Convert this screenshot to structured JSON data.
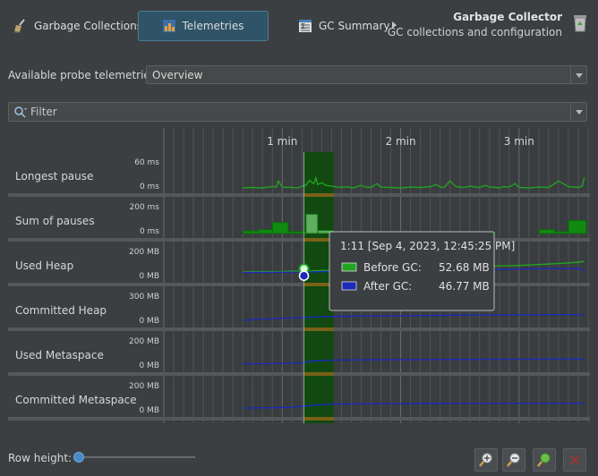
{
  "toolbar": {
    "tabs": [
      {
        "label": "Garbage Collections",
        "active": false,
        "icon": "broom-icon"
      },
      {
        "label": "Telemetries",
        "active": true,
        "icon": "telemetry-chart-icon"
      },
      {
        "label": "GC Summary",
        "active": false,
        "icon": "summary-table-icon"
      }
    ],
    "header_title": "Garbage Collector",
    "header_subtitle": "GC collections and configuration"
  },
  "probe": {
    "label": "Available probe telemetries:",
    "selected": "Overview"
  },
  "filter": {
    "placeholder": "Filter"
  },
  "chart_data": {
    "type": "line",
    "x_unit": "min",
    "x_ticks": [
      {
        "label": "1 min",
        "value": 60
      },
      {
        "label": "2 min",
        "value": 120
      },
      {
        "label": "3 min",
        "value": 180
      }
    ],
    "xlim": [
      0,
      215
    ],
    "highlight_range": [
      71,
      86
    ],
    "cursor_x": 71,
    "rows": [
      {
        "label": "Longest pause",
        "ymax_label": "60 ms",
        "ymin_label": "0 ms",
        "ymax": 60,
        "kind": "pause",
        "series": [
          {
            "name": "Longest pause",
            "color": "#21a121",
            "x": [
              40,
              45,
              50,
              55,
              57,
              58,
              60,
              65,
              68,
              70,
              72,
              74,
              75,
              76,
              77,
              78,
              80,
              82,
              85,
              88,
              90,
              93,
              95,
              97,
              100,
              102,
              105,
              108,
              110,
              115,
              120,
              125,
              130,
              135,
              138,
              140,
              142,
              145,
              148,
              150,
              152,
              155,
              158,
              160,
              163,
              165,
              168,
              170,
              172,
              175,
              178,
              180,
              185,
              190,
              195,
              200,
              205,
              210,
              212,
              213
            ],
            "y": [
              2,
              3,
              2,
              5,
              4,
              18,
              4,
              3,
              2,
              6,
              8,
              20,
              15,
              12,
              25,
              10,
              14,
              8,
              6,
              4,
              3,
              5,
              2,
              3,
              8,
              4,
              3,
              12,
              4,
              3,
              2,
              4,
              3,
              5,
              10,
              4,
              3,
              18,
              5,
              4,
              3,
              6,
              4,
              3,
              8,
              4,
              3,
              2,
              5,
              4,
              12,
              3,
              2,
              4,
              3,
              18,
              5,
              3,
              6,
              26
            ]
          }
        ]
      },
      {
        "label": "Sum of pauses",
        "ymax_label": "200 ms",
        "ymin_label": "0 ms",
        "ymax": 200,
        "kind": "bars",
        "bars": [
          {
            "x0": 40,
            "x1": 48,
            "v": 20
          },
          {
            "x0": 48,
            "x1": 55,
            "v": 30
          },
          {
            "x0": 55,
            "x1": 63,
            "v": 85
          },
          {
            "x0": 63,
            "x1": 72,
            "v": 15
          },
          {
            "x0": 72,
            "x1": 78,
            "v": 150
          },
          {
            "x0": 78,
            "x1": 86,
            "v": 25
          },
          {
            "x0": 160,
            "x1": 168,
            "v": 10
          },
          {
            "x0": 190,
            "x1": 198,
            "v": 30
          },
          {
            "x0": 198,
            "x1": 205,
            "v": 15
          },
          {
            "x0": 205,
            "x1": 214,
            "v": 100
          }
        ]
      },
      {
        "label": "Used Heap",
        "ymax_label": "200 MB",
        "ymin_label": "0 MB",
        "ymax": 200,
        "kind": "lines",
        "series": [
          {
            "name": "Before GC",
            "color": "#22a522",
            "x": [
              40,
              50,
              60,
              66,
              71,
              76,
              82,
              88,
              95,
              105,
              115,
              125,
              135,
              145,
              155,
              165,
              175,
              185,
              195,
              205,
              210,
              213
            ],
            "y": [
              50,
              51,
              52,
              56,
              52.68,
              57,
              60,
              62,
              66,
              68,
              70,
              72,
              76,
              80,
              88,
              95,
              96,
              102,
              110,
              118,
              124,
              130
            ]
          },
          {
            "name": "After GC",
            "color": "#1d2ab8",
            "x": [
              40,
              50,
              60,
              66,
              71,
              76,
              82,
              88,
              95,
              105,
              115,
              125,
              135,
              145,
              155,
              165,
              175,
              185,
              195,
              205,
              210,
              213
            ],
            "y": [
              44,
              45,
              46,
              47,
              46.77,
              50,
              52,
              53,
              55,
              57,
              60,
              62,
              62,
              63,
              64,
              66,
              70,
              73,
              75,
              74,
              76,
              60
            ]
          }
        ]
      },
      {
        "label": "Committed Heap",
        "ymax_label": "300 MB",
        "ymin_label": "0 MB",
        "ymax": 300,
        "kind": "lines",
        "series": [
          {
            "name": "Committed Heap",
            "color": "#1d2ab8",
            "x": [
              40,
              45,
              50,
              55,
              60,
              65,
              70,
              75,
              80,
              85,
              90,
              100,
              110,
              120,
              130,
              140,
              150,
              160,
              170,
              180,
              190,
              200,
              210,
              213
            ],
            "y": [
              30,
              40,
              45,
              50,
              55,
              58,
              62,
              66,
              72,
              75,
              78,
              80,
              82,
              84,
              86,
              88,
              90,
              92,
              94,
              95,
              96,
              96,
              96,
              96
            ]
          }
        ]
      },
      {
        "label": "Used Metaspace",
        "ymax_label": "200 MB",
        "ymin_label": "0 MB",
        "ymax": 200,
        "kind": "lines",
        "series": [
          {
            "name": "Used Metaspace",
            "color": "#1d2ab8",
            "x": [
              40,
              50,
              60,
              65,
              70,
              72,
              75,
              80,
              86,
              90,
              100,
              110,
              120,
              130,
              140,
              150,
              160,
              170,
              180,
              190,
              200,
              210,
              213
            ],
            "y": [
              30,
              32,
              34,
              36,
              38,
              45,
              52,
              55,
              58,
              60,
              61,
              62,
              63,
              63,
              64,
              64,
              65,
              65,
              65,
              66,
              66,
              66,
              66
            ]
          }
        ]
      },
      {
        "label": "Committed Metaspace",
        "ymax_label": "200 MB",
        "ymin_label": "0 MB",
        "ymax": 200,
        "kind": "lines",
        "series": [
          {
            "name": "Committed Metaspace",
            "color": "#1d2ab8",
            "x": [
              40,
              50,
              60,
              65,
              70,
              75,
              80,
              86,
              90,
              100,
              110,
              120,
              130,
              140,
              150,
              160,
              170,
              180,
              190,
              200,
              210,
              213
            ],
            "y": [
              34,
              36,
              38,
              42,
              48,
              55,
              60,
              65,
              66,
              67,
              68,
              68,
              69,
              69,
              70,
              70,
              70,
              71,
              71,
              71,
              71,
              71
            ]
          }
        ]
      }
    ],
    "tooltip": {
      "title": "1:11 [Sep 4, 2023, 12:45:25 PM]",
      "items": [
        {
          "name": "Before GC:",
          "value": "52.68 MB",
          "color": "#22a522"
        },
        {
          "name": "After GC:",
          "value": "46.77 MB",
          "color": "#1d2ab8"
        }
      ]
    }
  },
  "bottom": {
    "row_height_label": "Row height:",
    "slider_value": 0,
    "buttons": [
      {
        "icon": "zoom-in-icon"
      },
      {
        "icon": "zoom-out-icon"
      },
      {
        "icon": "zoom-fit-icon"
      },
      {
        "icon": "reset-zoom-icon"
      }
    ]
  }
}
